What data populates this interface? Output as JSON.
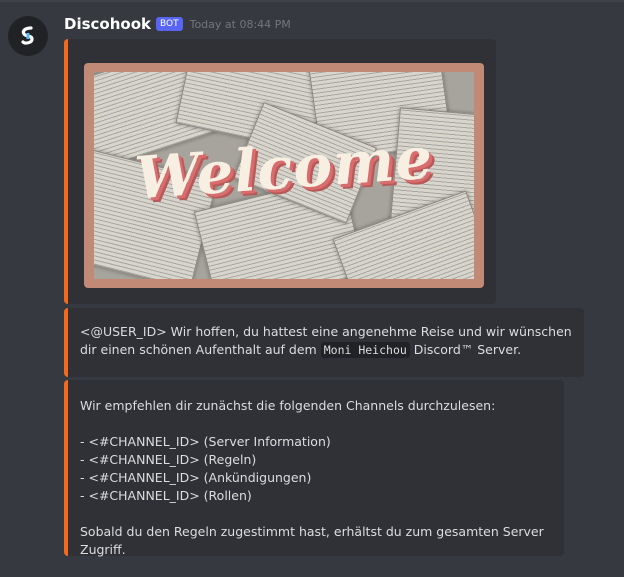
{
  "message": {
    "author": "Discohook",
    "badge": "BOT",
    "timestamp": "Today at 08:44 PM",
    "avatar_icon": "discohook-logo-icon"
  },
  "embeds": [
    {
      "image_text": "Welcome",
      "border_color": "#f46a1c"
    },
    {
      "mention": "<@USER_ID>",
      "text_before": " Wir hoffen, du hattest eine angenehme Reise und wir wünschen dir einen schönen Aufenthalt auf dem ",
      "code": "Moni Heichou",
      "text_after": " Discord™ Server.",
      "border_color": "#f46a1c"
    },
    {
      "intro": "Wir empfehlen dir zunächst die folgenden Channels durchzulesen:",
      "channels": [
        "- <#CHANNEL_ID> (Server Information)",
        "- <#CHANNEL_ID> (Regeln)",
        "- <#CHANNEL_ID> (Ankündigungen)",
        "- <#CHANNEL_ID> (Rollen)"
      ],
      "outro": "Sobald du den Regeln zugestimmt hast, erhältst du zum gesamten Server Zugriff.",
      "border_color": "#f46a1c"
    }
  ],
  "colors": {
    "background": "#36393f",
    "embed_background": "#2f3136",
    "bot_badge": "#5865f2"
  }
}
